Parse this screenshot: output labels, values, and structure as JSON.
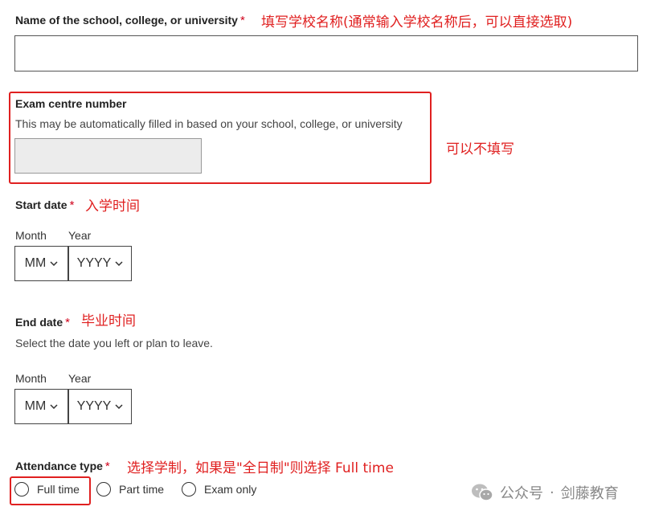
{
  "school": {
    "label": "Name of the school, college, or university",
    "required_mark": "*",
    "note": "填写学校名称(通常输入学校名称后，可以直接选取)",
    "value": ""
  },
  "exam_centre": {
    "label": "Exam centre number",
    "hint": "This may be automatically filled in based on your school, college, or university",
    "value": "",
    "note": "可以不填写"
  },
  "start_date": {
    "label": "Start date",
    "required_mark": "*",
    "note": "入学时间",
    "month_label": "Month",
    "year_label": "Year",
    "month_value": "MM",
    "year_value": "YYYY"
  },
  "end_date": {
    "label": "End date",
    "required_mark": "*",
    "note": "毕业时间",
    "hint": "Select the date you left or plan to leave.",
    "month_label": "Month",
    "year_label": "Year",
    "month_value": "MM",
    "year_value": "YYYY"
  },
  "attendance": {
    "label": "Attendance type",
    "required_mark": "*",
    "note": "选择学制，如果是\"全日制\"则选择 Full time",
    "options": [
      "Full time",
      "Part time",
      "Exam only"
    ]
  },
  "watermark": {
    "separator": "·",
    "text": "公众号",
    "name": "剑藤教育",
    "icon": "wechat-icon"
  },
  "colors": {
    "annotation": "#e02020",
    "required": "#d0021b"
  }
}
